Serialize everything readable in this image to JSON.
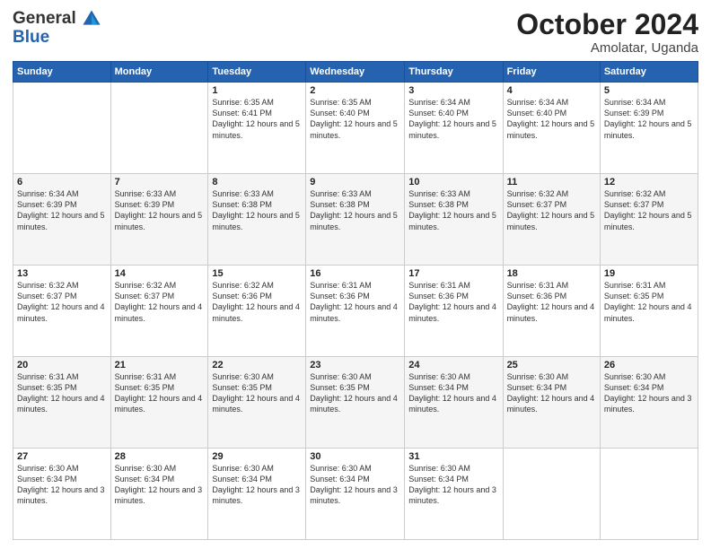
{
  "header": {
    "logo_line1": "General",
    "logo_line2": "Blue",
    "month": "October 2024",
    "location": "Amolatar, Uganda"
  },
  "weekdays": [
    "Sunday",
    "Monday",
    "Tuesday",
    "Wednesday",
    "Thursday",
    "Friday",
    "Saturday"
  ],
  "weeks": [
    [
      {
        "day": "",
        "info": ""
      },
      {
        "day": "",
        "info": ""
      },
      {
        "day": "1",
        "info": "Sunrise: 6:35 AM\nSunset: 6:41 PM\nDaylight: 12 hours and 5 minutes."
      },
      {
        "day": "2",
        "info": "Sunrise: 6:35 AM\nSunset: 6:40 PM\nDaylight: 12 hours and 5 minutes."
      },
      {
        "day": "3",
        "info": "Sunrise: 6:34 AM\nSunset: 6:40 PM\nDaylight: 12 hours and 5 minutes."
      },
      {
        "day": "4",
        "info": "Sunrise: 6:34 AM\nSunset: 6:40 PM\nDaylight: 12 hours and 5 minutes."
      },
      {
        "day": "5",
        "info": "Sunrise: 6:34 AM\nSunset: 6:39 PM\nDaylight: 12 hours and 5 minutes."
      }
    ],
    [
      {
        "day": "6",
        "info": "Sunrise: 6:34 AM\nSunset: 6:39 PM\nDaylight: 12 hours and 5 minutes."
      },
      {
        "day": "7",
        "info": "Sunrise: 6:33 AM\nSunset: 6:39 PM\nDaylight: 12 hours and 5 minutes."
      },
      {
        "day": "8",
        "info": "Sunrise: 6:33 AM\nSunset: 6:38 PM\nDaylight: 12 hours and 5 minutes."
      },
      {
        "day": "9",
        "info": "Sunrise: 6:33 AM\nSunset: 6:38 PM\nDaylight: 12 hours and 5 minutes."
      },
      {
        "day": "10",
        "info": "Sunrise: 6:33 AM\nSunset: 6:38 PM\nDaylight: 12 hours and 5 minutes."
      },
      {
        "day": "11",
        "info": "Sunrise: 6:32 AM\nSunset: 6:37 PM\nDaylight: 12 hours and 5 minutes."
      },
      {
        "day": "12",
        "info": "Sunrise: 6:32 AM\nSunset: 6:37 PM\nDaylight: 12 hours and 5 minutes."
      }
    ],
    [
      {
        "day": "13",
        "info": "Sunrise: 6:32 AM\nSunset: 6:37 PM\nDaylight: 12 hours and 4 minutes."
      },
      {
        "day": "14",
        "info": "Sunrise: 6:32 AM\nSunset: 6:37 PM\nDaylight: 12 hours and 4 minutes."
      },
      {
        "day": "15",
        "info": "Sunrise: 6:32 AM\nSunset: 6:36 PM\nDaylight: 12 hours and 4 minutes."
      },
      {
        "day": "16",
        "info": "Sunrise: 6:31 AM\nSunset: 6:36 PM\nDaylight: 12 hours and 4 minutes."
      },
      {
        "day": "17",
        "info": "Sunrise: 6:31 AM\nSunset: 6:36 PM\nDaylight: 12 hours and 4 minutes."
      },
      {
        "day": "18",
        "info": "Sunrise: 6:31 AM\nSunset: 6:36 PM\nDaylight: 12 hours and 4 minutes."
      },
      {
        "day": "19",
        "info": "Sunrise: 6:31 AM\nSunset: 6:35 PM\nDaylight: 12 hours and 4 minutes."
      }
    ],
    [
      {
        "day": "20",
        "info": "Sunrise: 6:31 AM\nSunset: 6:35 PM\nDaylight: 12 hours and 4 minutes."
      },
      {
        "day": "21",
        "info": "Sunrise: 6:31 AM\nSunset: 6:35 PM\nDaylight: 12 hours and 4 minutes."
      },
      {
        "day": "22",
        "info": "Sunrise: 6:30 AM\nSunset: 6:35 PM\nDaylight: 12 hours and 4 minutes."
      },
      {
        "day": "23",
        "info": "Sunrise: 6:30 AM\nSunset: 6:35 PM\nDaylight: 12 hours and 4 minutes."
      },
      {
        "day": "24",
        "info": "Sunrise: 6:30 AM\nSunset: 6:34 PM\nDaylight: 12 hours and 4 minutes."
      },
      {
        "day": "25",
        "info": "Sunrise: 6:30 AM\nSunset: 6:34 PM\nDaylight: 12 hours and 4 minutes."
      },
      {
        "day": "26",
        "info": "Sunrise: 6:30 AM\nSunset: 6:34 PM\nDaylight: 12 hours and 3 minutes."
      }
    ],
    [
      {
        "day": "27",
        "info": "Sunrise: 6:30 AM\nSunset: 6:34 PM\nDaylight: 12 hours and 3 minutes."
      },
      {
        "day": "28",
        "info": "Sunrise: 6:30 AM\nSunset: 6:34 PM\nDaylight: 12 hours and 3 minutes."
      },
      {
        "day": "29",
        "info": "Sunrise: 6:30 AM\nSunset: 6:34 PM\nDaylight: 12 hours and 3 minutes."
      },
      {
        "day": "30",
        "info": "Sunrise: 6:30 AM\nSunset: 6:34 PM\nDaylight: 12 hours and 3 minutes."
      },
      {
        "day": "31",
        "info": "Sunrise: 6:30 AM\nSunset: 6:34 PM\nDaylight: 12 hours and 3 minutes."
      },
      {
        "day": "",
        "info": ""
      },
      {
        "day": "",
        "info": ""
      }
    ]
  ]
}
